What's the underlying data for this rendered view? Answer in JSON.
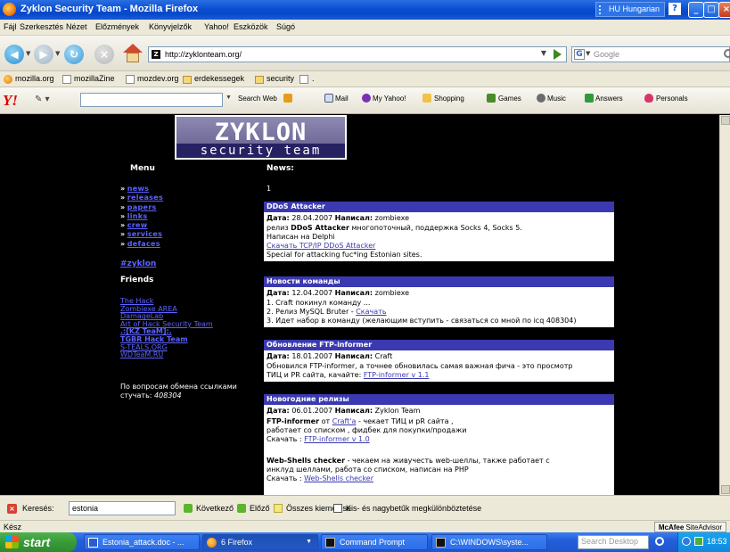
{
  "window": {
    "title": "Zyklon Security Team - Mozilla Firefox",
    "language": "HU Hungarian",
    "help": "?"
  },
  "menubar": [
    "Fájl",
    "Szerkesztés",
    "Nézet",
    "Előzmények",
    "Könyvjelzők",
    "Yahoo!",
    "Eszközök",
    "Súgó"
  ],
  "nav": {
    "url": "http://zyklonteam.org/",
    "search_placeholder": "Google",
    "favicon_letter": "Z"
  },
  "bookmarks": [
    "mozilla.org",
    "mozillaZine",
    "mozdev.org",
    "erdekessegek",
    "security",
    "."
  ],
  "yahoo_toolbar": {
    "logo": "Y!",
    "search_web": "Search Web",
    "items": [
      "Mail",
      "My Yahoo!",
      "Shopping",
      "Games",
      "Music",
      "Answers",
      "Personals"
    ]
  },
  "site": {
    "logo_line1": "ZYKLON",
    "logo_line2": "security team",
    "menu_title": "Menu",
    "menu_items": [
      "news",
      "releases",
      "papers",
      "links",
      "crew",
      "services",
      "defaces"
    ],
    "bullet": "»",
    "zyklon_link": "#zyklon",
    "friends_title": "Friends",
    "friends": [
      "The Hack",
      "Zombiexe AREA",
      "DamageLab",
      "Art of Hack Security Team",
      ".:[KZ TeaM]:.",
      "TGBR Hack Team",
      "S-TEALS.ORG",
      "WDTeaM.RU"
    ],
    "exchange_text": "По вопросам обмена ссылками стучать:",
    "exchange_icq": "408304",
    "news_title": "News:",
    "news_page": "1",
    "meta_date_label": "Дата:",
    "meta_author_label": "Написал:",
    "articles": [
      {
        "title": "DDoS Attacker",
        "date": "28.04.2007",
        "author": "zombiexe",
        "line1_pre": "релиз",
        "line1_bold": "DDoS Attacker",
        "line1_post": "многопоточный, поддержка Socks 4, Socks 5.",
        "line2": "Написан на Delphi",
        "link": "Скачать TCP/IP DDoS Attacker",
        "line3": "Special for attacking fuc*ing Estonian sites."
      },
      {
        "title": "Новости команды",
        "date": "12.04.2007",
        "author": "zombiexe",
        "line1": "1. Craft покинул команду ...",
        "line2_pre": "2. Релиз MySQL Bruter -",
        "line2_link": "Скачать",
        "line3": "3. Идет набор в команду (желающим вступить - связаться со мной по icq 408304)"
      },
      {
        "title": "Обновление FTP-informer",
        "date": "18.01.2007",
        "author": "Craft",
        "line1": "Обновился FTP-informer, а точнее обновилась самая важная фича - это просмотр",
        "line2_pre": "ТИЦ и PR сайта, качайте:",
        "line2_link": "FTP-informer v 1.1"
      },
      {
        "title": "Новогодние релизы",
        "date": "06.01.2007",
        "author": "Zyklon Team",
        "p1_bold": "FTP-informer",
        "p1_mid": "от",
        "p1_link": "Craft'a",
        "p1_post": "- чекает ТИЦ и pR сайта ,",
        "p1_line2": "работает со списком , фидбек для покупки/продажи",
        "p1_dl": "Скачать :",
        "p1_dl_link": "FTP-informer v 1.0",
        "p2_bold": "Web-Shells checker",
        "p2_post": "- чекаем на живучесть web-шеллы, также работает с",
        "p2_line2": "инклуд шеллами, работа со списком, написан на PHP",
        "p2_dl": "Скачать :",
        "p2_dl_link": "Web-Shells checker"
      }
    ]
  },
  "findbar": {
    "label": "Keresés:",
    "value": "estonia",
    "next": "Következő",
    "prev": "Előző",
    "highlight": "Összes kiemelése",
    "match_case": "Kis- és nagybetűk megkülönböztetése"
  },
  "status": {
    "text": "Kész",
    "mcafee_bold": "McAfee",
    "mcafee_rest": "SiteAdvisor"
  },
  "taskbar": {
    "start": "start",
    "tasks": [
      "Estonia_attack.doc - ...",
      "6 Firefox",
      "Command Prompt",
      "C:\\WINDOWS\\syste..."
    ],
    "search": "Search Desktop",
    "time": "18:53"
  }
}
